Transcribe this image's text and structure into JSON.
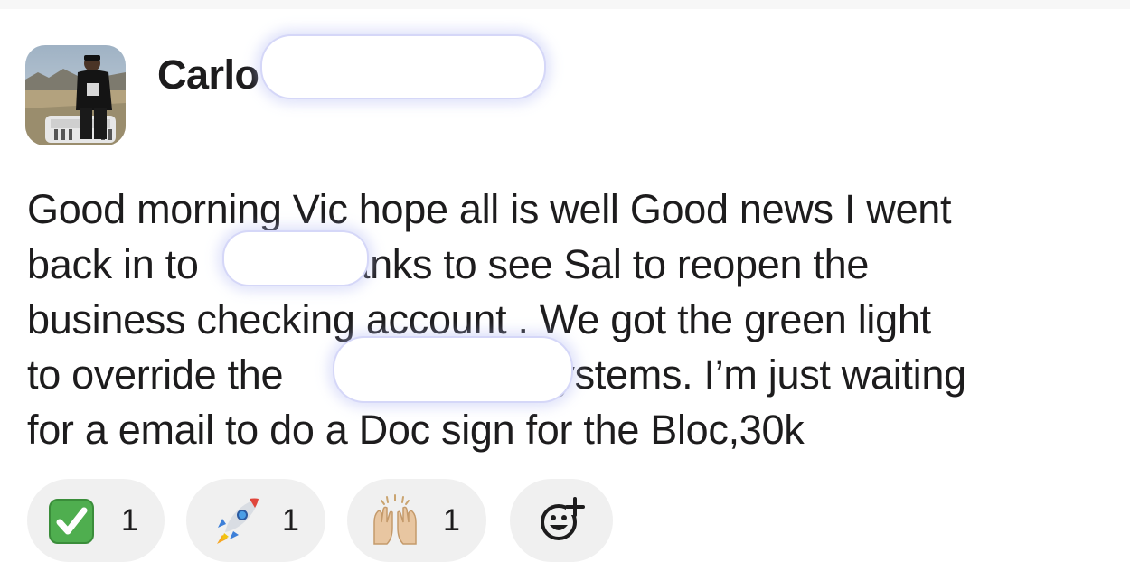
{
  "message": {
    "author": "Carlo",
    "lines": [
      "Good morning Vic hope all is well Good news I went",
      "back in to",
      "banks to see Sal to reopen the",
      "business checking account .  We got the green light",
      "to override the",
      "systems. I’m just waiting",
      "for a email to do a Doc sign for the Bloc,30k"
    ]
  },
  "reactions": [
    {
      "icon": "white-check-mark-emoji-icon",
      "count": "1"
    },
    {
      "icon": "rocket-emoji-icon",
      "count": "1"
    },
    {
      "icon": "raised-hands-emoji-icon",
      "count": "1"
    }
  ],
  "add_reaction": {
    "icon": "add-reaction-icon"
  },
  "colors": {
    "text": "#1d1c1d",
    "pill_background": "#f0f0f0",
    "check_green": "#4fae4f",
    "redaction_glow": "#b9bef5"
  }
}
